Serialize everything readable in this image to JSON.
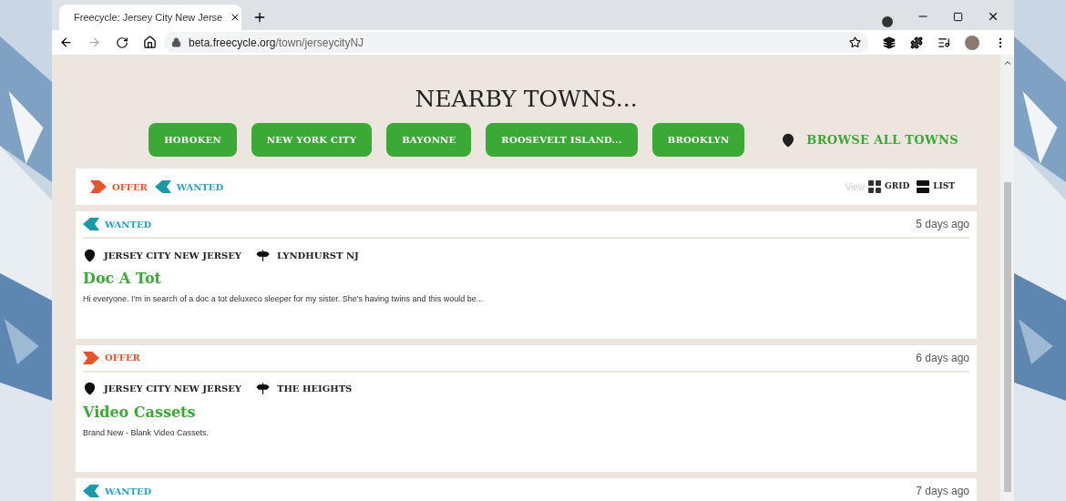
{
  "browser": {
    "tab_title": "Freecycle: Jersey City New Jerse",
    "url_host": "beta.freecycle.org",
    "url_path": "/town/jerseycityNJ"
  },
  "nearby": {
    "heading": "NEARBY TOWNS...",
    "towns": [
      "HOBOKEN",
      "NEW YORK CITY",
      "BAYONNE",
      "ROOSEVELT ISLAND...",
      "BROOKLYN"
    ],
    "browse_all": "BROWSE ALL TOWNS"
  },
  "filters": [
    {
      "kind": "offer",
      "label": "OFFER"
    },
    {
      "kind": "wanted",
      "label": "WANTED"
    }
  ],
  "view": {
    "label": "View",
    "options": [
      {
        "kind": "grid",
        "label": "GRID"
      },
      {
        "kind": "list",
        "label": "LIST"
      }
    ]
  },
  "posts": [
    {
      "kind": "wanted",
      "type_label": "WANTED",
      "time": "5 days ago",
      "location": "JERSEY CITY NEW JERSEY",
      "area": "LYNDHURST NJ",
      "title": "Doc A Tot",
      "body": "Hi everyone. I'm in search of a doc a tot deluxeco sleeper for my sister. She's having twins and this would be..."
    },
    {
      "kind": "offer",
      "type_label": "OFFER",
      "time": "6 days ago",
      "location": "JERSEY CITY NEW JERSEY",
      "area": "THE HEIGHTS",
      "title": "Video Cassets",
      "body": "Brand New - Blank Video Cassets."
    },
    {
      "kind": "wanted",
      "type_label": "WANTED",
      "time": "7 days ago"
    }
  ]
}
